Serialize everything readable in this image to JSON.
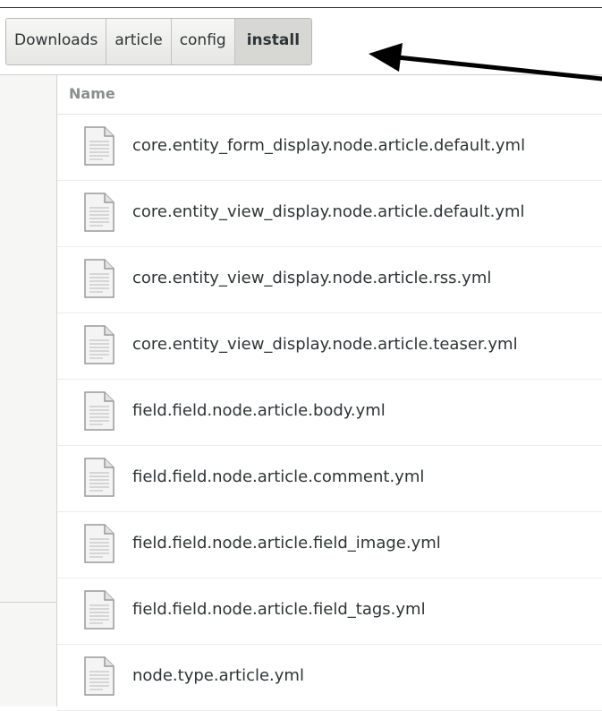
{
  "pathbar": {
    "crumbs": [
      "Downloads",
      "article",
      "config",
      "install"
    ],
    "active_index": 3
  },
  "columns": {
    "name": "Name"
  },
  "files": [
    {
      "name": "core.entity_form_display.node.article.default.yml",
      "icon": "text-file-icon"
    },
    {
      "name": "core.entity_view_display.node.article.default.yml",
      "icon": "text-file-icon"
    },
    {
      "name": "core.entity_view_display.node.article.rss.yml",
      "icon": "text-file-icon"
    },
    {
      "name": "core.entity_view_display.node.article.teaser.yml",
      "icon": "text-file-icon"
    },
    {
      "name": "field.field.node.article.body.yml",
      "icon": "text-file-icon"
    },
    {
      "name": "field.field.node.article.comment.yml",
      "icon": "text-file-icon"
    },
    {
      "name": "field.field.node.article.field_image.yml",
      "icon": "text-file-icon"
    },
    {
      "name": "field.field.node.article.field_tags.yml",
      "icon": "text-file-icon"
    },
    {
      "name": "node.type.article.yml",
      "icon": "text-file-icon"
    }
  ],
  "annotation": {
    "icon": "arrow-icon",
    "color": "#000000"
  }
}
